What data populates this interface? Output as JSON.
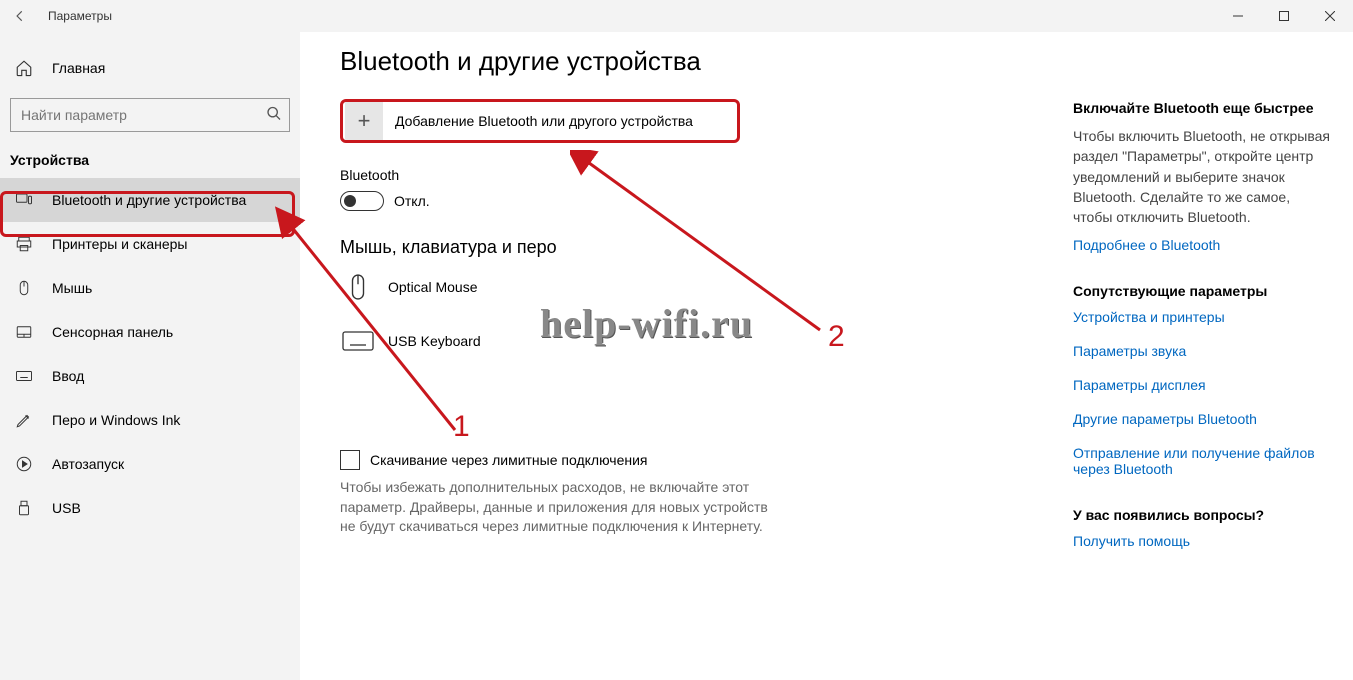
{
  "window": {
    "title": "Параметры"
  },
  "sidebar": {
    "home": "Главная",
    "search_placeholder": "Найти параметр",
    "category": "Устройства",
    "items": [
      {
        "label": "Bluetooth и другие устройства"
      },
      {
        "label": "Принтеры и сканеры"
      },
      {
        "label": "Мышь"
      },
      {
        "label": "Сенсорная панель"
      },
      {
        "label": "Ввод"
      },
      {
        "label": "Перо и Windows Ink"
      },
      {
        "label": "Автозапуск"
      },
      {
        "label": "USB"
      }
    ]
  },
  "main": {
    "title": "Bluetooth и другие устройства",
    "add_device": "Добавление Bluetooth или другого устройства",
    "bt_label": "Bluetooth",
    "bt_state": "Откл.",
    "section_mouse": "Мышь, клавиатура и перо",
    "devices": [
      {
        "label": "Optical Mouse"
      },
      {
        "label": "USB Keyboard"
      }
    ],
    "metered_title": "Скачивание через лимитные подключения",
    "metered_help": "Чтобы избежать дополнительных расходов, не включайте этот параметр. Драйверы, данные и приложения для новых устройств не будут скачиваться через лимитные подключения к Интернету."
  },
  "right": {
    "bt_fast_title": "Включайте Bluetooth еще быстрее",
    "bt_fast_text": "Чтобы включить Bluetooth, не открывая раздел \"Параметры\", откройте центр уведомлений и выберите значок Bluetooth. Сделайте то же самое, чтобы отключить Bluetooth.",
    "bt_more": "Подробнее о Bluetooth",
    "related_title": "Сопутствующие параметры",
    "links": [
      "Устройства и принтеры",
      "Параметры звука",
      "Параметры дисплея",
      "Другие параметры Bluetooth",
      "Отправление или получение файлов через Bluetooth"
    ],
    "questions_title": "У вас появились вопросы?",
    "get_help": "Получить помощь"
  },
  "watermark": "help-wifi.ru",
  "annotations": {
    "one": "1",
    "two": "2"
  }
}
